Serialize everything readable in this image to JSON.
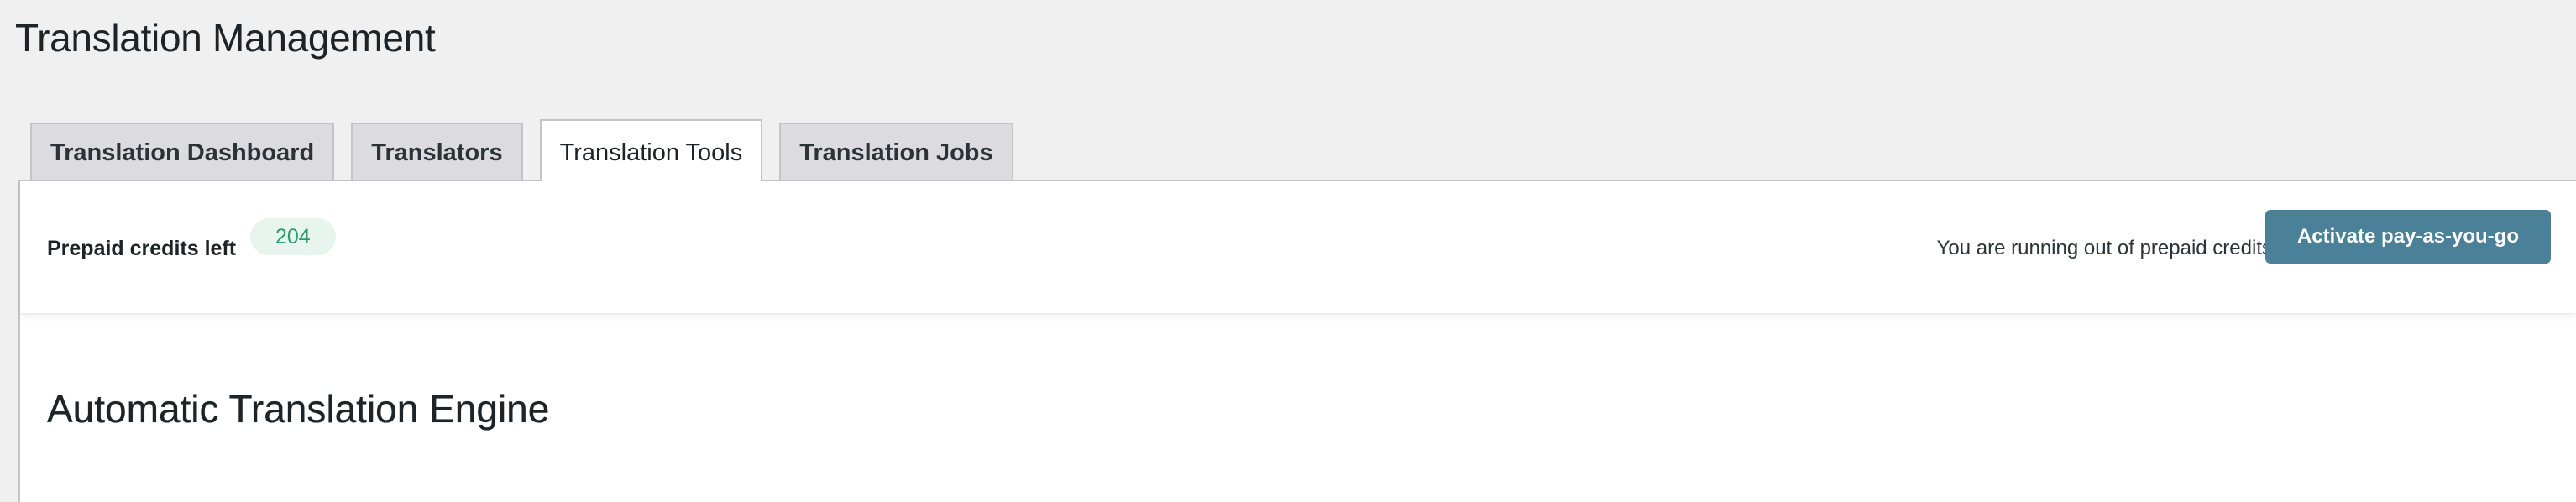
{
  "page": {
    "title": "Translation Management"
  },
  "tabs": [
    {
      "label": "Translation Dashboard",
      "active": false
    },
    {
      "label": "Translators",
      "active": false
    },
    {
      "label": "Translation Tools",
      "active": true
    },
    {
      "label": "Translation Jobs",
      "active": false
    }
  ],
  "credits": {
    "label": "Prepaid credits left",
    "value": "204",
    "warning": "You are running out of prepaid credits",
    "button_label": "Activate pay-as-you-go"
  },
  "section": {
    "title": "Automatic Translation Engine"
  },
  "colors": {
    "accent_button": "#4a8199",
    "badge_bg": "#e8f4ee",
    "badge_text": "#2e9b6b",
    "page_bg": "#f0f0f1"
  }
}
